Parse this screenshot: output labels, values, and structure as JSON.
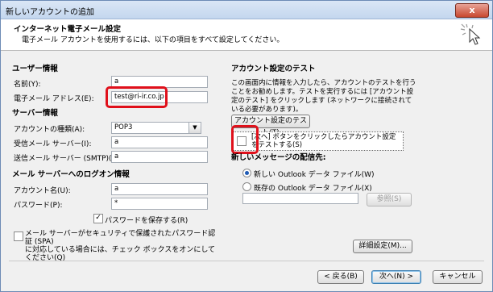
{
  "window": {
    "title": "新しいアカウントの追加",
    "close_label": "x"
  },
  "header": {
    "title": "インターネット電子メール設定",
    "subtitle": "電子メール アカウントを使用するには、以下の項目をすべて設定してください。"
  },
  "user_info": {
    "heading": "ユーザー情報",
    "name_label": "名前(Y):",
    "name_value": "a",
    "email_label": "電子メール アドレス(E):",
    "email_value": "test@ri-ir.co.jp"
  },
  "server_info": {
    "heading": "サーバー情報",
    "account_type_label": "アカウントの種類(A):",
    "account_type_value": "POP3",
    "incoming_label": "受信メール サーバー(I):",
    "incoming_value": "a",
    "outgoing_label": "送信メール サーバー (SMTP)(O):",
    "outgoing_value": "a"
  },
  "logon_info": {
    "heading": "メール サーバーへのログオン情報",
    "account_name_label": "アカウント名(U):",
    "account_name_value": "a",
    "password_label": "パスワード(P):",
    "password_value": "*",
    "remember_password_label": "パスワードを保存する(R)",
    "spa_label": "メール サーバーがセキュリティで保護されたパスワード認証 (SPA)\nに対応している場合には、チェック ボックスをオンにしてください(Q)"
  },
  "account_test": {
    "heading": "アカウント設定のテスト",
    "description": "この画面内に情報を入力したら、アカウントのテストを行うことをお勧めします。テストを実行するには [アカウント設定のテスト] をクリックします (ネットワークに接続されている必要があります)。",
    "test_button": "アカウント設定のテスト(T)",
    "auto_test_label": "[次へ] ボタンをクリックしたらアカウント設定をテストする(S)"
  },
  "delivery": {
    "heading": "新しいメッセージの配信先:",
    "new_file_label": "新しい Outlook データ ファイル(W)",
    "existing_file_label": "既存の Outlook データ ファイル(X)",
    "browse_button": "参照(S)"
  },
  "buttons": {
    "more_settings": "詳細設定(M)...",
    "back": "< 戻る(B)",
    "next": "次へ(N) >",
    "cancel": "キャンセル"
  },
  "icons": {
    "close": "close-icon",
    "checked": "check-icon",
    "dropdown": "chevron-down-icon",
    "cursor": "sparkle-cursor-icon"
  }
}
